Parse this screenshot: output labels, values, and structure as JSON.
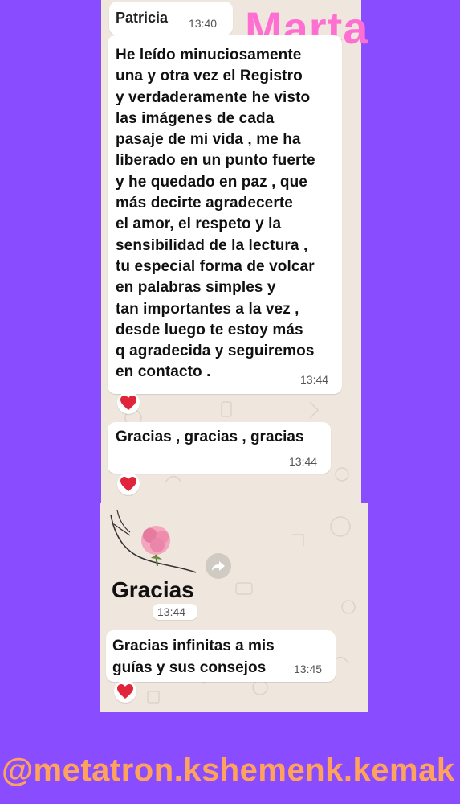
{
  "chat": {
    "sender": "Patricia",
    "sender_time": "13:40",
    "message_text": "He leído minuciosamente\nuna y otra vez el Registro\ny verdaderamente he visto\nlas imágenes de cada\npasaje de mi vida , me ha\nliberado en un punto fuerte\ny he quedado en paz , que\nmás decirte agradecerte\nel amor, el respeto y la\nsensibilidad de la lectura ,\ntu especial forma de volcar\nen palabras simples y\ntan importantes a la vez ,\ndesde luego te estoy más\nq agradecida y seguiremos\nen contacto .",
    "message_time": "13:44",
    "gracias_text": "Gracias , gracias , gracias",
    "gracias_time": "13:44",
    "sticker_text": "Gracias",
    "sticker_time": "13:44",
    "infinitas_text": "Gracias infinitas a mis\nguías y sus consejos",
    "infinitas_time": "13:45",
    "reaction_icon": "heart-icon"
  },
  "overlay": {
    "name": "Marta",
    "handle": "@metatron.kshemenk.kemak"
  },
  "colors": {
    "background": "#8a4cff",
    "chat_background": "#efe7dd",
    "name_pink": "#ff6fd2",
    "handle_orange": "#ffa35c",
    "heart_red": "#e0243a"
  }
}
